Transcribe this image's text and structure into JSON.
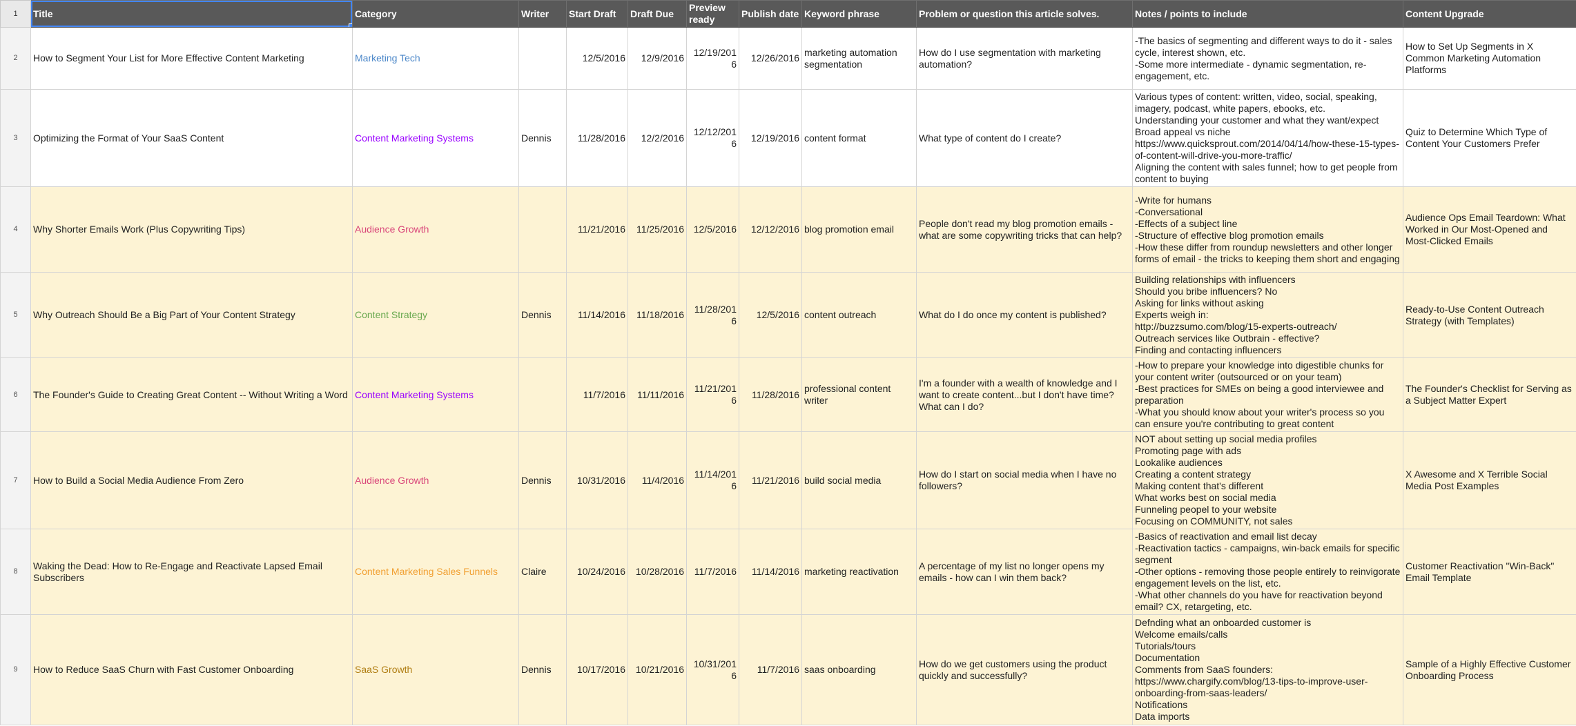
{
  "header": {
    "row_number": "1",
    "columns": [
      "Title",
      "Category",
      "Writer",
      "Start Draft",
      "Draft Due",
      "Preview ready",
      "Publish date",
      "Keyword phrase",
      "Problem or question this article solves.",
      "Notes / points to include",
      "Content Upgrade"
    ]
  },
  "category_colors": {
    "Marketing Tech": "#4a86c8",
    "Content Marketing Systems": "#9900ff",
    "Audience Growth": "#d9467a",
    "Content Strategy": "#6aa84f",
    "Content Marketing Sales Funnels": "#f1a033",
    "SaaS Growth": "#b07d12"
  },
  "rows": [
    {
      "row_number": "2",
      "band": "white",
      "title": "How to Segment Your List for More Effective Content Marketing",
      "category": "Marketing Tech",
      "writer": "",
      "start_draft": "12/5/2016",
      "draft_due": "12/9/2016",
      "preview_ready": "12/19/2016",
      "publish_date": "12/26/2016",
      "keyword": "marketing automation segmentation",
      "problem": "How do I use segmentation with marketing automation?",
      "notes": "-The basics of segmenting and different ways to do it - sales cycle, interest shown, etc.\n-Some more intermediate - dynamic segmentation, re-engagement, etc.",
      "upgrade": "How to Set Up Segments in X Common Marketing Automation Platforms"
    },
    {
      "row_number": "3",
      "band": "white",
      "title": "Optimizing the Format of Your SaaS Content",
      "category": "Content Marketing Systems",
      "writer": "Dennis",
      "start_draft": "11/28/2016",
      "draft_due": "12/2/2016",
      "preview_ready": "12/12/2016",
      "publish_date": "12/19/2016",
      "keyword": "content format",
      "problem": "What type of content do I create?",
      "notes": "Various types of content: written, video, social, speaking, imagery, podcast, white papers, ebooks, etc.\nUnderstanding your customer and what they want/expect\nBroad appeal vs niche\nhttps://www.quicksprout.com/2014/04/14/how-these-15-types-of-content-will-drive-you-more-traffic/\nAligning the content with sales funnel; how to get people from content to buying",
      "upgrade": "Quiz to Determine Which Type of Content Your Customers Prefer"
    },
    {
      "row_number": "4",
      "band": "cream",
      "title": "Why Shorter Emails Work (Plus Copywriting Tips)",
      "category": "Audience Growth",
      "writer": "",
      "start_draft": "11/21/2016",
      "draft_due": "11/25/2016",
      "preview_ready": "12/5/2016",
      "publish_date": "12/12/2016",
      "keyword": "blog promotion email",
      "problem": "People don't read my blog promotion emails - what are some copywriting tricks that can help?",
      "notes": "-Write for humans\n-Conversational\n-Effects of a subject line\n-Structure of effective blog promotion emails\n-How these differ from roundup newsletters and other longer forms of email - the tricks to keeping them short and engaging",
      "upgrade": "Audience Ops Email Teardown: What Worked in Our Most-Opened and Most-Clicked Emails"
    },
    {
      "row_number": "5",
      "band": "cream",
      "title": "Why Outreach Should Be a Big Part of Your Content Strategy",
      "category": "Content Strategy",
      "writer": "Dennis",
      "start_draft": "11/14/2016",
      "draft_due": "11/18/2016",
      "preview_ready": "11/28/2016",
      "publish_date": "12/5/2016",
      "keyword": "content outreach",
      "problem": "What do I do once my content is published?",
      "notes": "Building relationships with influencers\nShould you bribe influencers? No\nAsking for links without asking\nExperts weigh in:\nhttp://buzzsumo.com/blog/15-experts-outreach/\nOutreach services like Outbrain - effective?\nFinding and contacting influencers",
      "upgrade": "Ready-to-Use Content Outreach Strategy (with Templates)"
    },
    {
      "row_number": "6",
      "band": "cream",
      "title": "The Founder's Guide to Creating Great Content -- Without Writing a Word",
      "category": "Content Marketing Systems",
      "writer": "",
      "start_draft": "11/7/2016",
      "draft_due": "11/11/2016",
      "preview_ready": "11/21/2016",
      "publish_date": "11/28/2016",
      "keyword": "professional content writer",
      "problem": "I'm a founder with a wealth of knowledge and I want to create content...but I don't have time? What can I do?",
      "notes": "-How to prepare your knowledge into digestible chunks for your content writer (outsourced or on your team)\n-Best practices for SMEs on being a good interviewee and preparation\n-What you should know about your writer's process so you can ensure you're contributing to great content",
      "upgrade": "The Founder's Checklist for Serving as a Subject Matter Expert"
    },
    {
      "row_number": "7",
      "band": "cream",
      "title": "How to Build a Social Media Audience From Zero",
      "category": "Audience Growth",
      "writer": "Dennis",
      "start_draft": "10/31/2016",
      "draft_due": "11/4/2016",
      "preview_ready": "11/14/2016",
      "publish_date": "11/21/2016",
      "keyword": "build social media",
      "problem": "How do I start on social media when I have no followers?",
      "notes": "NOT about setting up social media profiles\nPromoting page with ads\nLookalike audiences\nCreating a content strategy\nMaking content that's different\nWhat works best on social media\nFunneling peopel to your website\nFocusing on COMMUNITY, not sales",
      "upgrade": "X Awesome and X Terrible Social Media Post Examples"
    },
    {
      "row_number": "8",
      "band": "cream",
      "title": "Waking the Dead: How to Re-Engage and Reactivate Lapsed Email Subscribers",
      "category": "Content Marketing Sales Funnels",
      "writer": "Claire",
      "start_draft": "10/24/2016",
      "draft_due": "10/28/2016",
      "preview_ready": "11/7/2016",
      "publish_date": "11/14/2016",
      "keyword": "marketing reactivation",
      "problem": "A percentage of my list no longer opens my emails - how can I win them back?",
      "notes": "-Basics of reactivation and email list decay\n-Reactivation tactics - campaigns, win-back emails for specific segment\n-Other options - removing those people entirely to reinvigorate engagement levels on the list, etc.\n-What other channels do you have for reactivation beyond email? CX, retargeting, etc.",
      "upgrade": "Customer Reactivation \"Win-Back\" Email Template"
    },
    {
      "row_number": "9",
      "band": "cream",
      "title": "How to Reduce SaaS Churn with Fast Customer Onboarding",
      "category": "SaaS Growth",
      "writer": "Dennis",
      "start_draft": "10/17/2016",
      "draft_due": "10/21/2016",
      "preview_ready": "10/31/2016",
      "publish_date": "11/7/2016",
      "keyword": "saas onboarding",
      "problem": "How do we get customers using the product quickly and successfully?",
      "notes": "Defnding what an onboarded customer is\nWelcome emails/calls\nTutorials/tours\nDocumentation\nComments from SaaS founders:\nhttps://www.chargify.com/blog/13-tips-to-improve-user-onboarding-from-saas-leaders/\nNotifications\nData imports",
      "upgrade": "Sample of a Highly Effective Customer Onboarding Process"
    }
  ]
}
